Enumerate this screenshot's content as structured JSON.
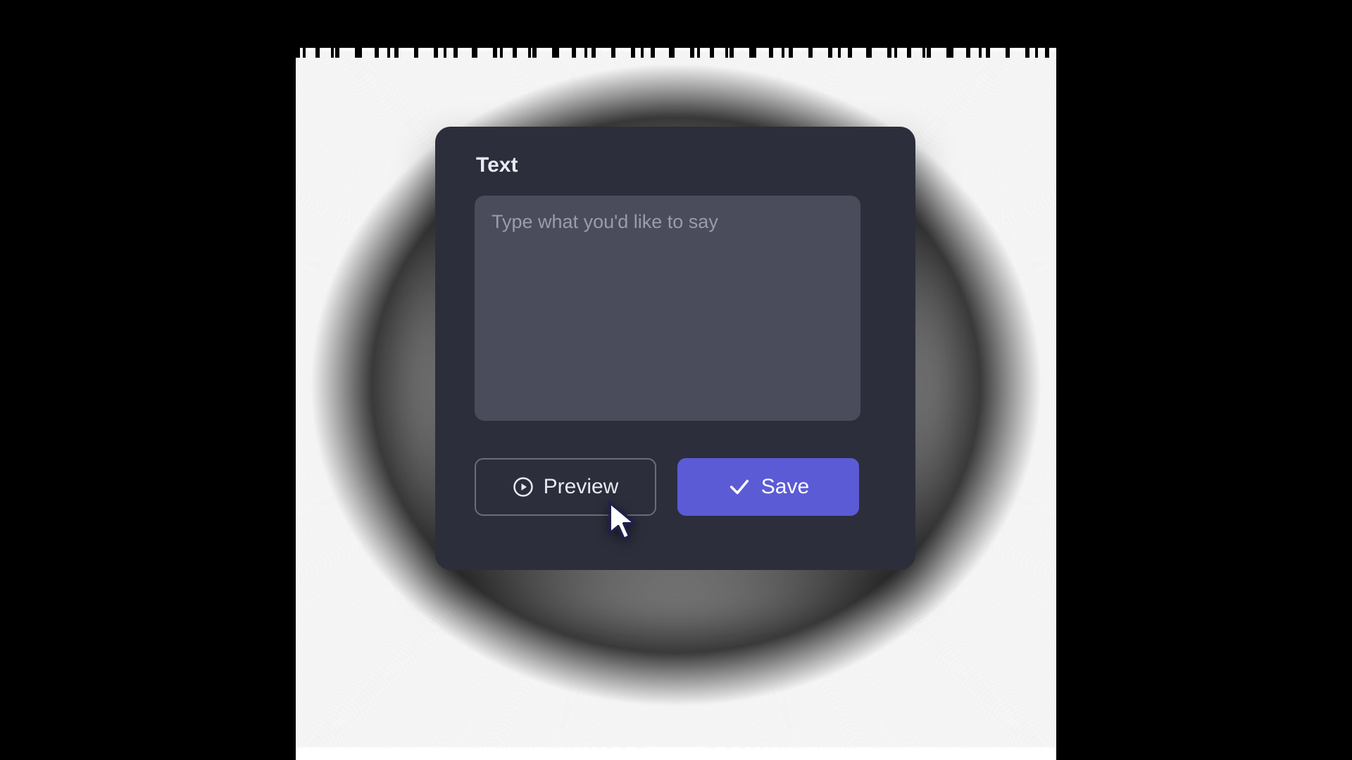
{
  "card": {
    "title": "Text",
    "textarea": {
      "value": "",
      "placeholder": "Type what you'd like to say"
    },
    "buttons": {
      "preview_label": "Preview",
      "save_label": "Save"
    }
  },
  "colors": {
    "accent": "#5b5bd6",
    "card_bg": "#2c2e3b",
    "input_bg": "#4a4c5b"
  }
}
